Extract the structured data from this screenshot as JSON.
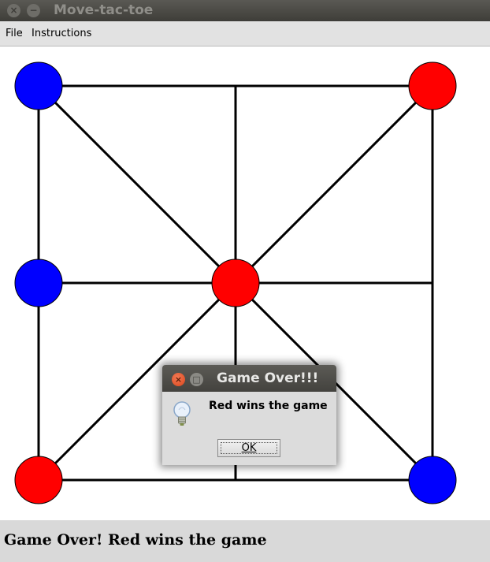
{
  "window": {
    "title": "Move-tac-toe",
    "close_symbol": "×",
    "minimize_symbol": "−"
  },
  "menu": {
    "items": [
      {
        "label": "File"
      },
      {
        "label": "Instructions"
      }
    ]
  },
  "board": {
    "line_color": "#000000",
    "pieces": [
      {
        "cell": "top-left",
        "color": "blue"
      },
      {
        "cell": "top-right",
        "color": "red"
      },
      {
        "cell": "middle-left",
        "color": "blue"
      },
      {
        "cell": "center",
        "color": "red"
      },
      {
        "cell": "bottom-left",
        "color": "red"
      },
      {
        "cell": "bottom-right",
        "color": "blue"
      }
    ],
    "colors": {
      "blue": "#0000ff",
      "red": "#ff0000"
    }
  },
  "dialog": {
    "title": "Game Over!!!",
    "message": "Red wins the game",
    "ok_label": "OK",
    "icon": "lightbulb-icon"
  },
  "status": {
    "text": "Game Over!  Red wins the game"
  }
}
